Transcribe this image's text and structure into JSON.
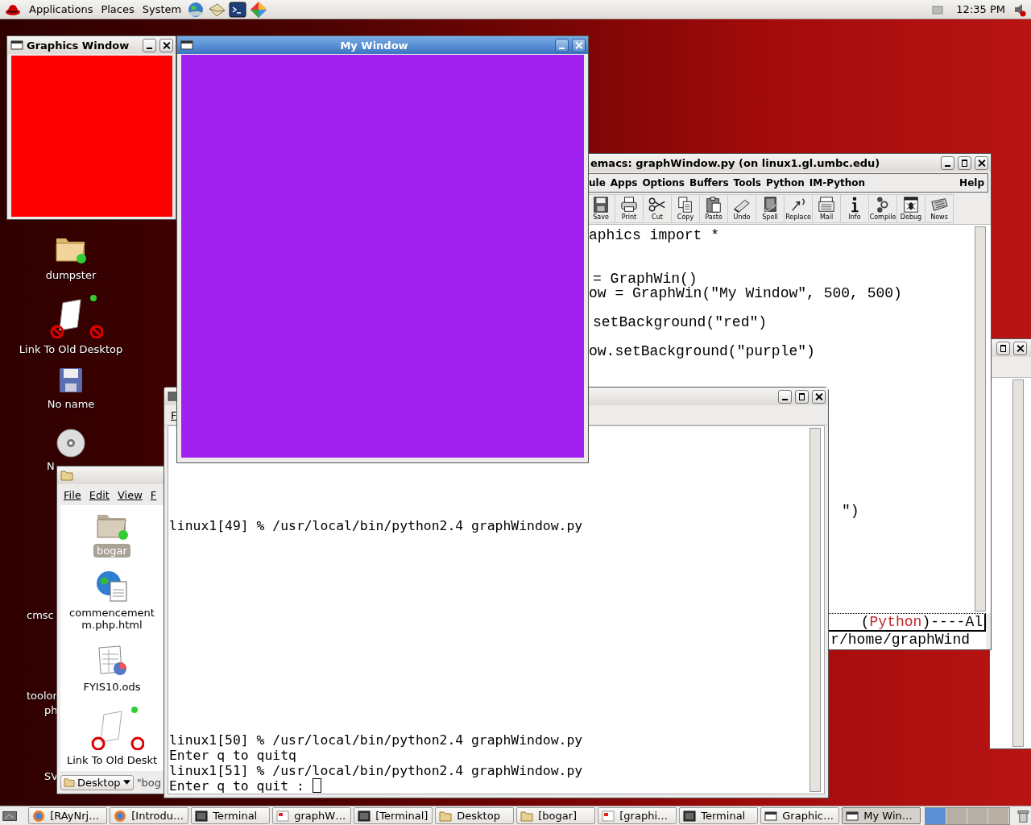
{
  "top_panel": {
    "menus": [
      "Applications",
      "Places",
      "System"
    ],
    "clock": "12:35 PM"
  },
  "desktop_icons": [
    {
      "label": "dumpster"
    },
    {
      "label": "Link To Old Desktop"
    },
    {
      "label": "No name"
    },
    {
      "label": "N"
    },
    {
      "label": "cmsc"
    },
    {
      "label": "toolor"
    },
    {
      "label": "ph"
    },
    {
      "label": "SV"
    }
  ],
  "graphics_window": {
    "title": "Graphics Window",
    "active": false
  },
  "my_window": {
    "title": "My Window",
    "active": true
  },
  "emacs": {
    "title": "emacs: graphWindow.py (on linux1.gl.umbc.edu)",
    "active": false,
    "menus": [
      "ule",
      "Apps",
      "Options",
      "Buffers",
      "Tools",
      "Python",
      "IM-Python"
    ],
    "help_menu": "Help",
    "tools": [
      "Save",
      "Print",
      "Cut",
      "Copy",
      "Paste",
      "Undo",
      "Spell",
      "Replace",
      "Mail",
      "Info",
      "Compile",
      "Debug",
      "News"
    ],
    "code": [
      "aphics import *",
      "= GraphWin()",
      "ow = GraphWin(\"My Window\", 500, 500)",
      "setBackground(\"red\")",
      "ow.setBackground(\"purple\")",
      "\")"
    ],
    "modeline": [
      {
        "text": "(",
        "kind": "plain"
      },
      {
        "text": "Python",
        "kind": "mode"
      },
      {
        "text": ")----Al",
        "kind": "plain"
      }
    ],
    "minibuffer": "r/home/graphWind"
  },
  "terminal": {
    "active": false,
    "menus": [
      "F"
    ],
    "lines": [
      "linux1[49] % /usr/local/bin/python2.4 graphWindow.py",
      "linux1[50] % /usr/local/bin/python2.4 graphWindow.py",
      "Enter q to quitq",
      "linux1[51] % /usr/local/bin/python2.4 graphWindow.py",
      "Enter q to quit : "
    ]
  },
  "file_manager": {
    "active": false,
    "menus": [
      "File",
      "Edit",
      "View",
      "F"
    ],
    "items": [
      {
        "label_lines": [
          "bogar"
        ],
        "selected": true
      },
      {
        "label_lines": [
          "commencement",
          "m.php.html"
        ],
        "selected": false
      },
      {
        "label_lines": [
          "FYIS10.ods"
        ],
        "selected": false
      },
      {
        "label_lines": [
          "Link To Old Deskt"
        ],
        "selected": false
      }
    ],
    "location": "Desktop",
    "path": "\"bog"
  },
  "taskbar": {
    "items": [
      {
        "label": "[RAyNrj…",
        "selected": false
      },
      {
        "label": "[Introdu…",
        "selected": false
      },
      {
        "label": "Terminal",
        "selected": false
      },
      {
        "label": "graphW…",
        "selected": false
      },
      {
        "label": "[Terminal]",
        "selected": false
      },
      {
        "label": "Desktop",
        "selected": false
      },
      {
        "label": "[bogar]",
        "selected": false
      },
      {
        "label": "[graphi…",
        "selected": false
      },
      {
        "label": "Terminal",
        "selected": false
      },
      {
        "label": "Graphic…",
        "selected": false
      },
      {
        "label": "My Win…",
        "selected": true
      }
    ],
    "workspaces": [
      {
        "selected": true
      },
      {
        "selected": false
      },
      {
        "selected": false
      },
      {
        "selected": false
      }
    ]
  }
}
